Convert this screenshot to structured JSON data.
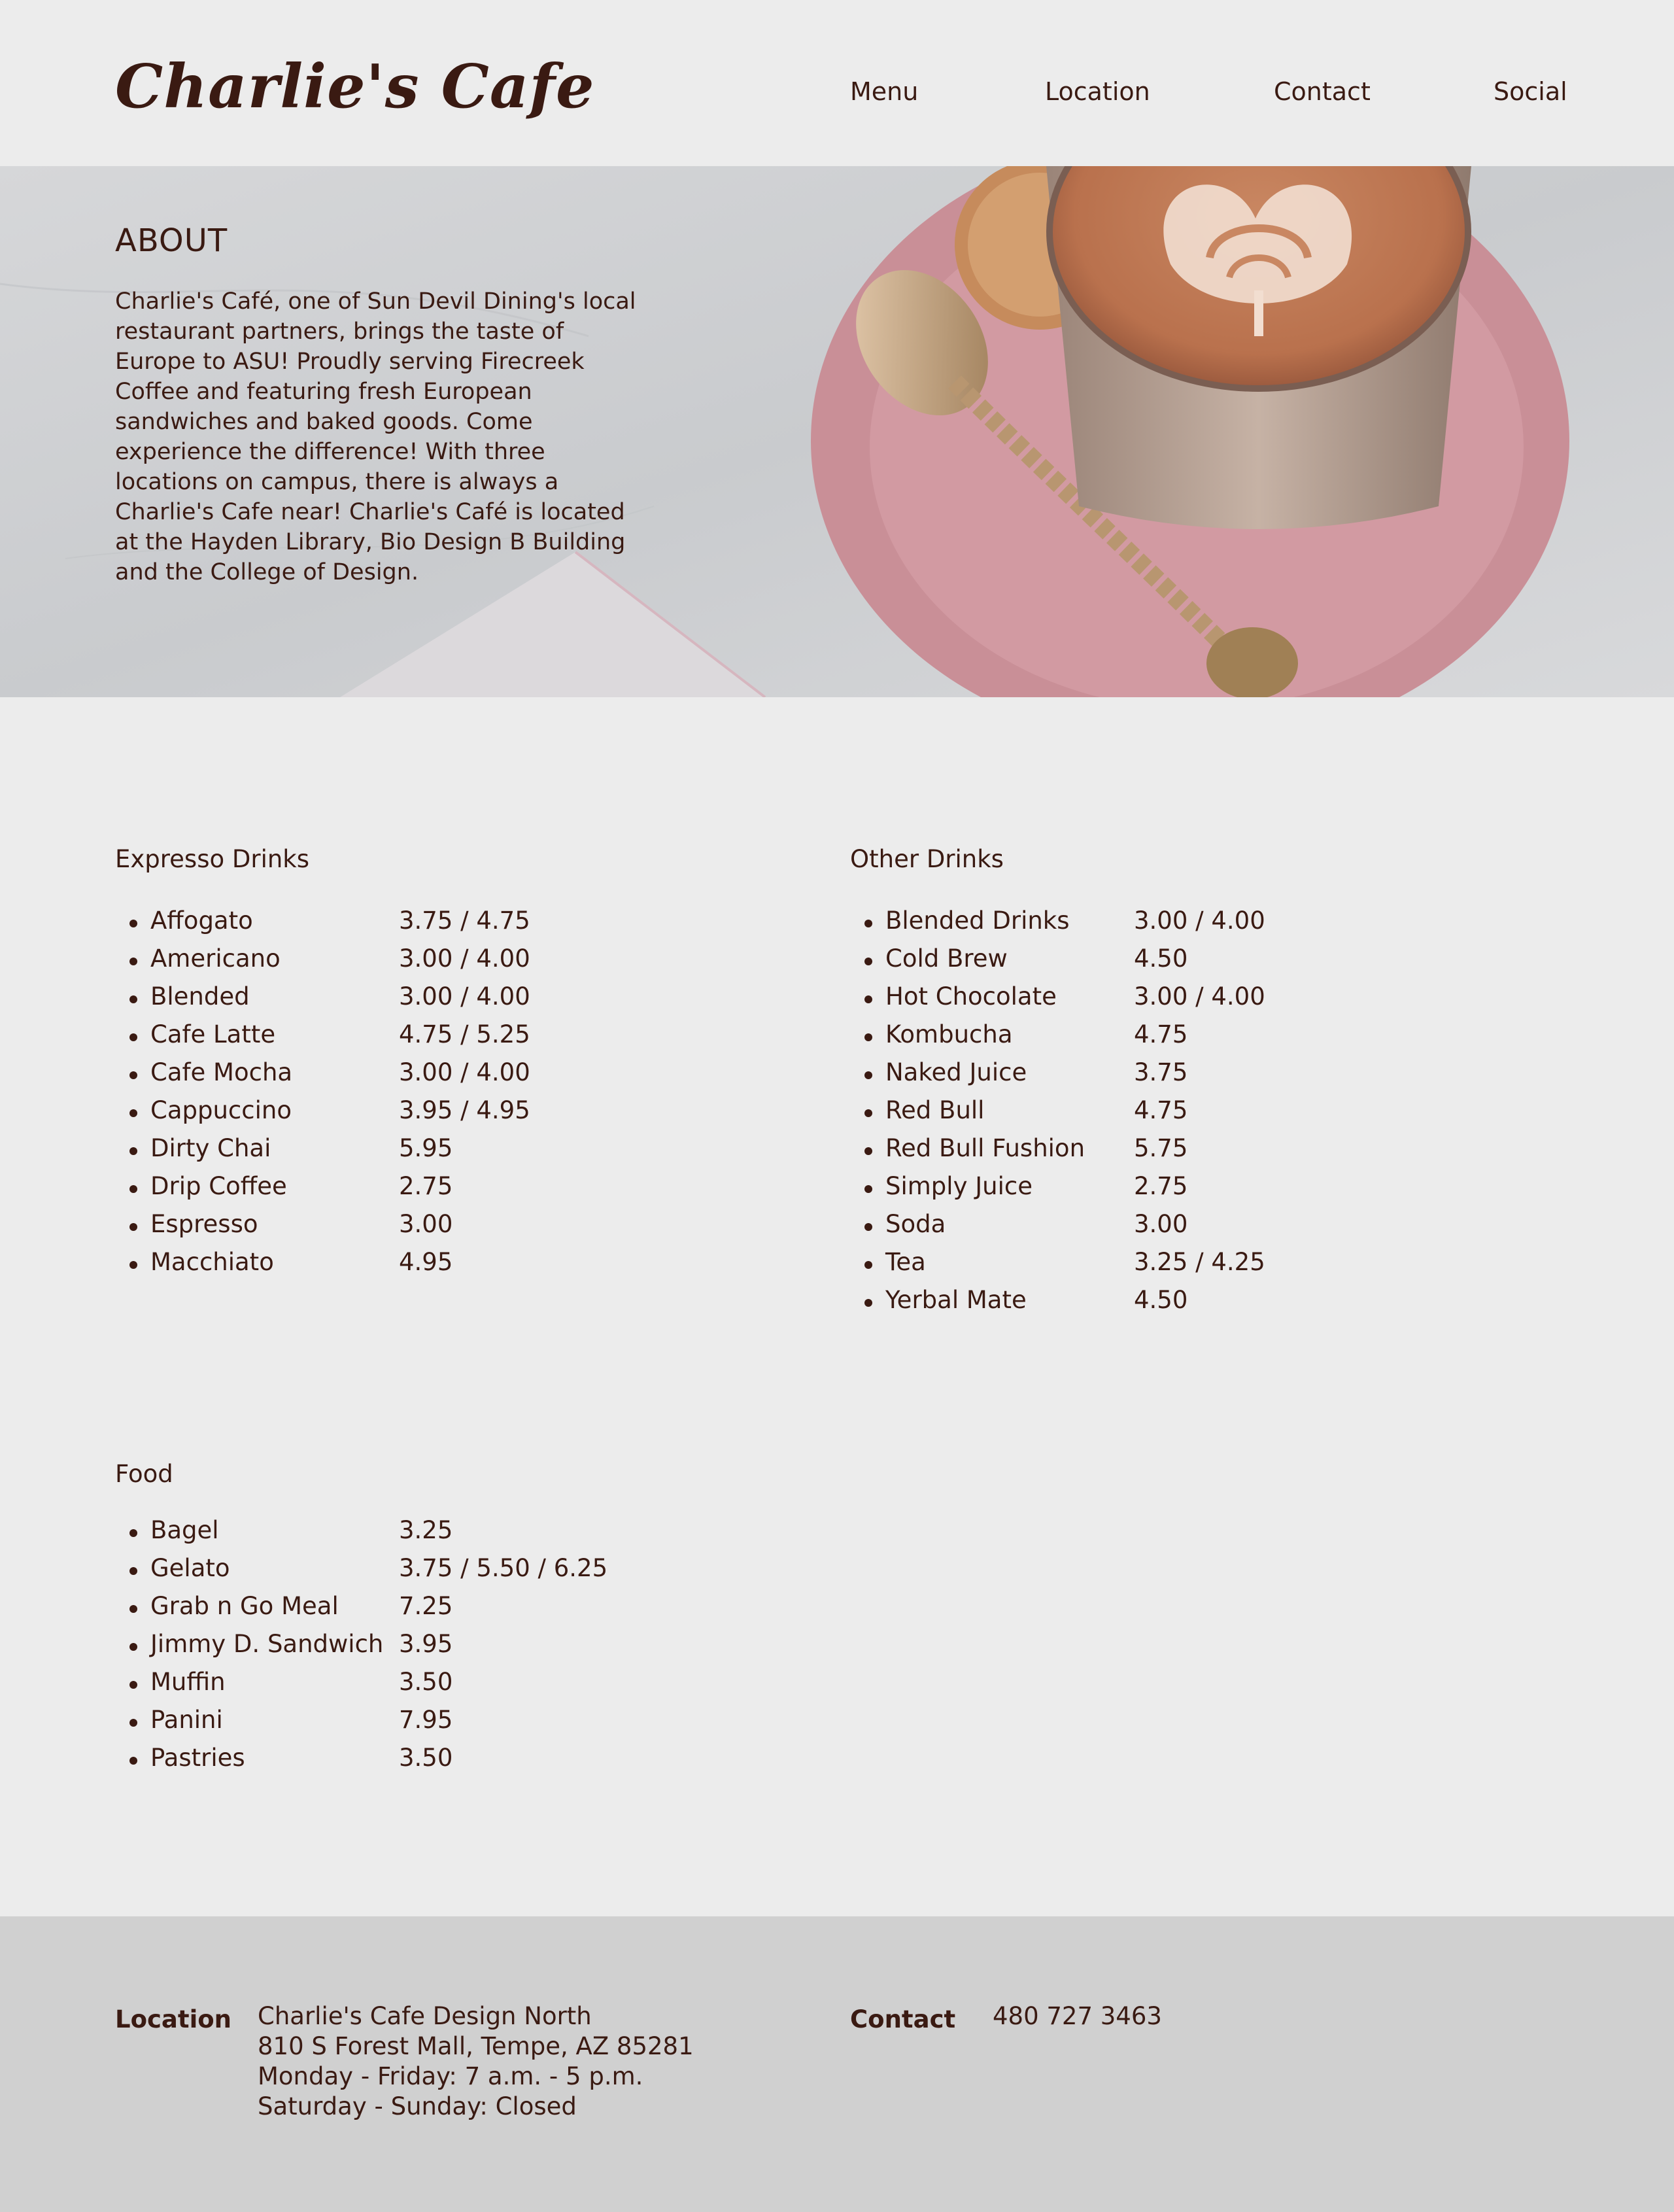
{
  "header": {
    "logo": "Charlie's Cafe",
    "nav": [
      "Menu",
      "Location",
      "Contact",
      "Social"
    ]
  },
  "about": {
    "title": "ABOUT",
    "text": "Charlie's Café, one of Sun Devil Dining's local restaurant partners, brings the taste of Europe to ASU! Proudly serving Firecreek Coffee and featuring fresh European sandwiches and baked goods. Come experience the difference! With three locations on campus, there is always a Charlie's Cafe near! Charlie's Café is located at the Hayden Library, Bio Design B Building and the College of Design."
  },
  "menu": {
    "espresso": {
      "title": "Expresso Drinks",
      "items": [
        {
          "name": "Affogato",
          "price": "3.75 / 4.75"
        },
        {
          "name": "Americano",
          "price": "3.00 / 4.00"
        },
        {
          "name": "Blended",
          "price": "3.00 / 4.00"
        },
        {
          "name": "Cafe Latte",
          "price": "4.75 / 5.25"
        },
        {
          "name": "Cafe Mocha",
          "price": "3.00 / 4.00"
        },
        {
          "name": "Cappuccino",
          "price": "3.95 / 4.95"
        },
        {
          "name": "Dirty Chai",
          "price": "5.95"
        },
        {
          "name": "Drip Coffee",
          "price": "2.75"
        },
        {
          "name": "Espresso",
          "price": "3.00"
        },
        {
          "name": "Macchiato",
          "price": "4.95"
        }
      ]
    },
    "other": {
      "title": "Other Drinks",
      "items": [
        {
          "name": "Blended Drinks",
          "price": "3.00 / 4.00"
        },
        {
          "name": "Cold Brew",
          "price": "4.50"
        },
        {
          "name": "Hot Chocolate",
          "price": "3.00 / 4.00"
        },
        {
          "name": "Kombucha",
          "price": "4.75"
        },
        {
          "name": "Naked Juice",
          "price": "3.75"
        },
        {
          "name": "Red Bull",
          "price": "4.75"
        },
        {
          "name": "Red Bull Fushion",
          "price": "5.75"
        },
        {
          "name": "Simply Juice",
          "price": "2.75"
        },
        {
          "name": "Soda",
          "price": "3.00"
        },
        {
          "name": "Tea",
          "price": "3.25 / 4.25"
        },
        {
          "name": "Yerbal Mate",
          "price": "4.50"
        }
      ]
    },
    "food": {
      "title": "Food",
      "items": [
        {
          "name": "Bagel",
          "price": "3.25"
        },
        {
          "name": "Gelato",
          "price": "3.75 / 5.50 / 6.25"
        },
        {
          "name": "Grab n Go Meal",
          "price": "7.25"
        },
        {
          "name": "Jimmy D. Sandwich",
          "price": "3.95"
        },
        {
          "name": "Muffin",
          "price": "3.50"
        },
        {
          "name": "Panini",
          "price": "7.95"
        },
        {
          "name": "Pastries",
          "price": "3.50"
        }
      ]
    }
  },
  "footer": {
    "location_label": "Location",
    "location_lines": [
      "Charlie's Cafe Design North",
      "810 S Forest Mall, Tempe, AZ 85281",
      "Monday - Friday: 7 a.m. - 5 p.m.",
      "Saturday - Sunday: Closed"
    ],
    "contact_label": "Contact",
    "phone": "480 727 3463"
  },
  "colors": {
    "text": "#3a1a12",
    "background": "#ececec",
    "footer_bg": "#d0d0d0",
    "saucer": "#c98f97"
  },
  "icons": {
    "hero_image": "latte-on-pink-saucer"
  }
}
